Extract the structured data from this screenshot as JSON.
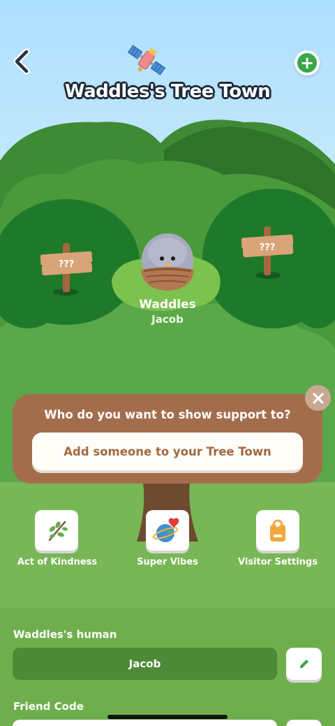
{
  "header": {
    "title": "Waddles's Tree Town",
    "back_icon": "chevron-left-icon",
    "add_icon": "plus-circle-icon",
    "satellite_icon": "satellite-icon"
  },
  "scene": {
    "left_sign": "???",
    "right_sign": "???",
    "pet_name": "Waddles",
    "pet_owner": "Jacob"
  },
  "support": {
    "question": "Who do you want to show support to?",
    "button_label": "Add someone to your Tree Town",
    "close_icon": "close-icon"
  },
  "actions": [
    {
      "label": "Act of Kindness",
      "icon": "leaf-branch-icon"
    },
    {
      "label": "Super Vibes",
      "icon": "globe-heart-icon"
    },
    {
      "label": "Visitor Settings",
      "icon": "door-hanger-icon"
    }
  ],
  "profile": {
    "human_label": "Waddles's human",
    "human_value": "Jacob",
    "friend_code_label": "Friend Code"
  },
  "colors": {
    "brand_green": "#3aa84a",
    "card_brown": "#a36d4c",
    "panel_green": "#6fae4d",
    "field_green": "#4d8a37"
  }
}
